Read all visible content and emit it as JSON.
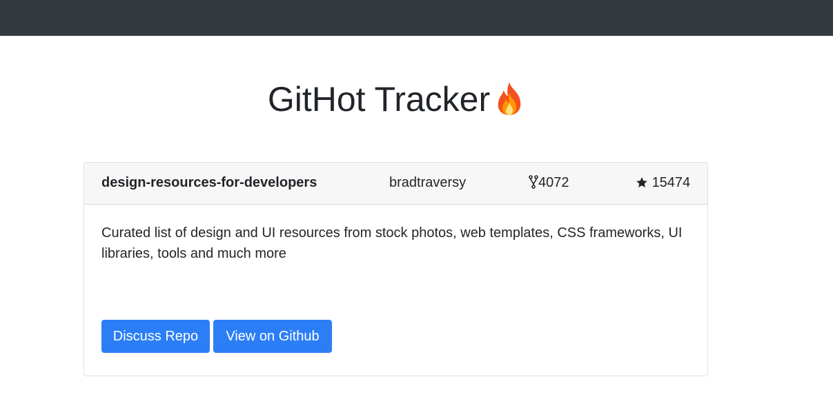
{
  "header": {
    "title": "GitHot Tracker",
    "title_icon": "fire-icon"
  },
  "repo_card": {
    "name": "design-resources-for-developers",
    "owner": "bradtraversy",
    "forks": "4072",
    "forks_icon": "fork-icon",
    "stars": "15474",
    "stars_icon": "star-icon",
    "description": "Curated list of design and UI resources from stock photos, web templates, CSS frameworks, UI libraries, tools and much more",
    "discuss_label": "Discuss Repo",
    "github_label": "View on Github"
  },
  "colors": {
    "navbar": "#343a40",
    "button": "#2c7ef7",
    "card_header": "#f7f7f7"
  }
}
